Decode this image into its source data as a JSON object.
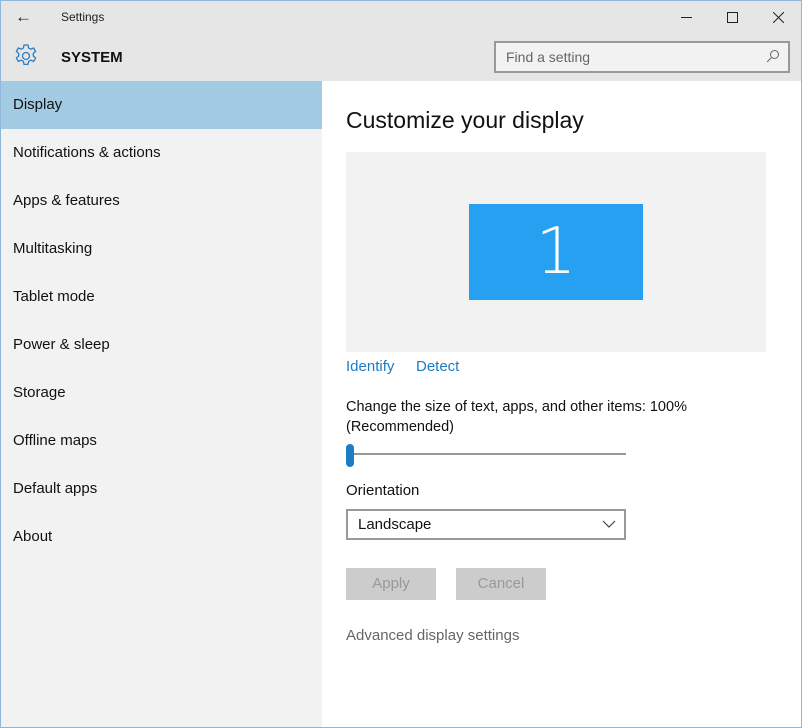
{
  "window": {
    "title": "Settings",
    "minimize": "—",
    "maximize": "☐",
    "close": "✕",
    "back": "←"
  },
  "header": {
    "section": "SYSTEM",
    "search_placeholder": "Find a setting"
  },
  "sidebar": {
    "items": [
      {
        "label": "Display",
        "selected": true
      },
      {
        "label": "Notifications & actions"
      },
      {
        "label": "Apps & features"
      },
      {
        "label": "Multitasking"
      },
      {
        "label": "Tablet mode"
      },
      {
        "label": "Power & sleep"
      },
      {
        "label": "Storage"
      },
      {
        "label": "Offline maps"
      },
      {
        "label": "Default apps"
      },
      {
        "label": "About"
      }
    ]
  },
  "main": {
    "title": "Customize your display",
    "monitor_number": "1",
    "identify": "Identify",
    "detect": "Detect",
    "scale_label": "Change the size of text, apps, and other items: 100%",
    "scale_note": "(Recommended)",
    "scale_slider_value": 0,
    "orientation_label": "Orientation",
    "orientation_value": "Landscape",
    "apply": "Apply",
    "cancel": "Cancel",
    "advanced": "Advanced display settings"
  },
  "colors": {
    "accent": "#1c7cc4",
    "selected": "#a2cbe3",
    "monitor": "#26a0f0"
  }
}
